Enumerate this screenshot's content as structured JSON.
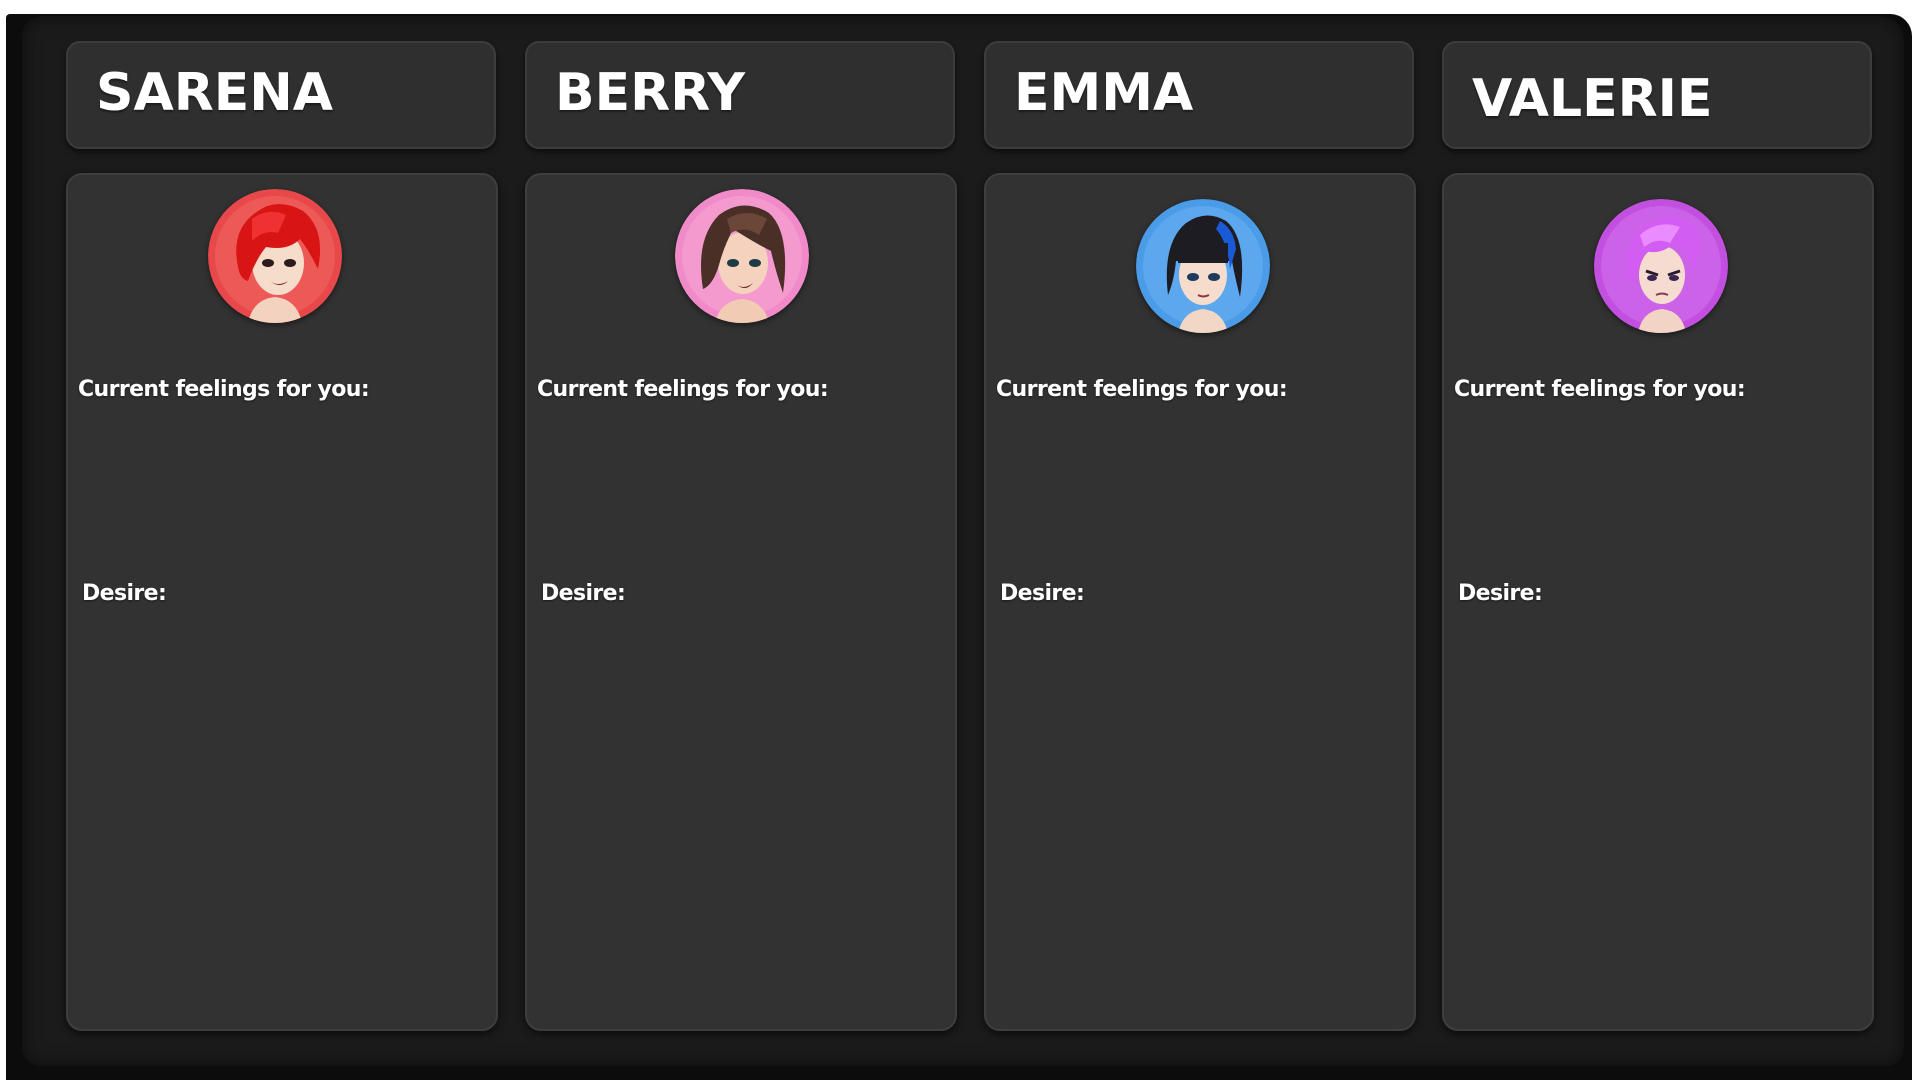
{
  "characters": [
    {
      "name": "SARENA",
      "feelings_label": "Current feelings for you:",
      "desire_label": "Desire:",
      "avatar_icon": "red-haired-woman-portrait-icon",
      "avatar_bg": "#e8484a",
      "hair_color": "#d81414"
    },
    {
      "name": "BERRY",
      "feelings_label": "Current feelings for you:",
      "desire_label": "Desire:",
      "avatar_icon": "brown-haired-woman-portrait-icon",
      "avatar_bg": "#f08ac8",
      "hair_color": "#4a2f27"
    },
    {
      "name": "EMMA",
      "feelings_label": "Current feelings for you:",
      "desire_label": "Desire:",
      "avatar_icon": "black-blue-haired-woman-portrait-icon",
      "avatar_bg": "#4a9be8",
      "hair_color": "#1c1c22"
    },
    {
      "name": "VALERIE",
      "feelings_label": "Current feelings for you:",
      "desire_label": "Desire:",
      "avatar_icon": "purple-haired-woman-portrait-icon",
      "avatar_bg": "#c24fe0",
      "hair_color": "#d35cf2"
    }
  ],
  "colors": {
    "frame": "#0c0c0c",
    "panel": "#1b1b1b",
    "card": "#323232",
    "text": "#ffffff"
  }
}
